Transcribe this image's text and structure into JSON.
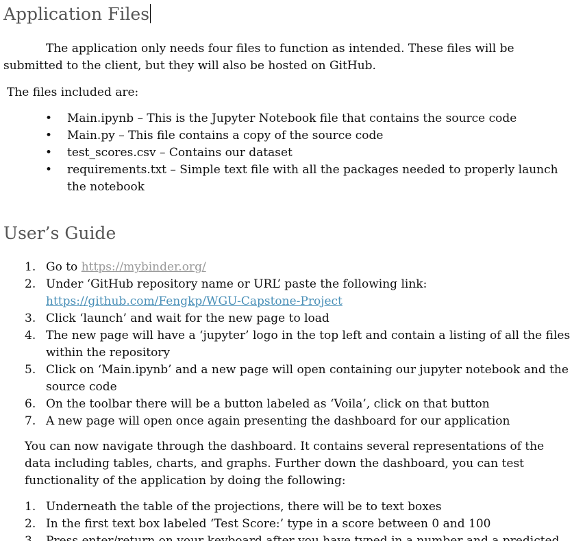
{
  "section1": {
    "heading": "Application Files",
    "intro_line1": "The application only needs four files to function as intended. These files will be",
    "intro_line2": "submitted to the client, but they will also be hosted on GitHub.",
    "files_label": "The files included are:",
    "bullets": [
      {
        "lines": [
          "Main.ipynb – This is the Jupyter Notebook file that contains the source code"
        ]
      },
      {
        "lines": [
          "Main.py – This file contains a copy of the source code"
        ]
      },
      {
        "lines": [
          "test_scores.csv – Contains our dataset"
        ]
      },
      {
        "lines": [
          "requirements.txt – Simple text file with all the packages needed to properly launch",
          "the notebook"
        ]
      }
    ]
  },
  "section2": {
    "heading": "User’s Guide",
    "steps": [
      {
        "num": "1.",
        "before": "Go to ",
        "link": "https://mybinder.org/"
      },
      {
        "num": "2.",
        "text": "Under ‘GitHub repository name or URL’ paste the following link:",
        "link": "https://github.com/Fengkp/WGU-Capstone-Project"
      },
      {
        "num": "3.",
        "text": "Click ‘launch’ and wait for the new page to load"
      },
      {
        "num": "4.",
        "lines": [
          "The new page will have a ‘jupyter’ logo in the top left and contain a listing of all the files",
          "within the repository"
        ]
      },
      {
        "num": "5.",
        "lines": [
          "Click on ‘Main.ipynb’ and a new page will open containing our jupyter notebook and the",
          "source code"
        ]
      },
      {
        "num": "6.",
        "text": "On the toolbar there will be a button labeled as ‘Voila’, click on that button"
      },
      {
        "num": "7.",
        "text": "A new page will open once again presenting the dashboard for our application"
      }
    ],
    "nav_line1": "You can now navigate through the dashboard. It contains several representations of the",
    "nav_line2": "data including tables, charts, and graphs. Further down the dashboard, you can test",
    "nav_line3": "functionality of the application by doing the following:",
    "test_steps": [
      {
        "num": "1.",
        "text": "Underneath the table of the projections, there will be to text boxes"
      },
      {
        "num": "2.",
        "text": "In the first text box labeled ‘Test Score:’ type in a score between 0 and 100"
      },
      {
        "num": "3.",
        "text": "Press enter/return on your keyboard after you have typed in a number and a predicted"
      }
    ]
  },
  "colors": {
    "heading": "#555555",
    "text": "#111111",
    "link_visited": "#9a9a9a",
    "link": "#4a90b8"
  }
}
